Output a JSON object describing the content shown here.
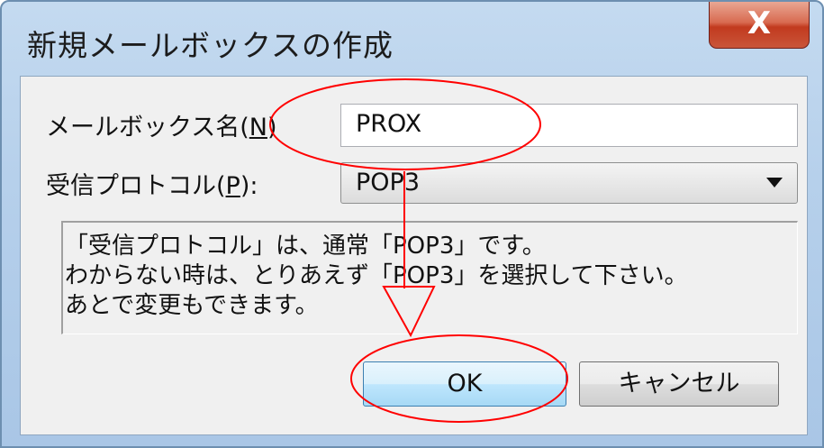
{
  "window": {
    "title": "新規メールボックスの作成",
    "close_label": "X"
  },
  "form": {
    "mailbox_label": "メールボックス名(",
    "mailbox_key": "N",
    "mailbox_suffix": ")",
    "mailbox_value": "PROX",
    "protocol_label": "受信プロトコル(",
    "protocol_key": "P",
    "protocol_suffix": "):",
    "protocol_value": "POP3"
  },
  "info_lines": [
    "「受信プロトコル」は、通常「POP3」です。",
    "わからない時は、とりあえず「POP3」を選択して下さい。",
    "あとで変更もできます。"
  ],
  "buttons": {
    "ok": "OK",
    "cancel": "キャンセル"
  },
  "annotation_color": "#ff0000"
}
